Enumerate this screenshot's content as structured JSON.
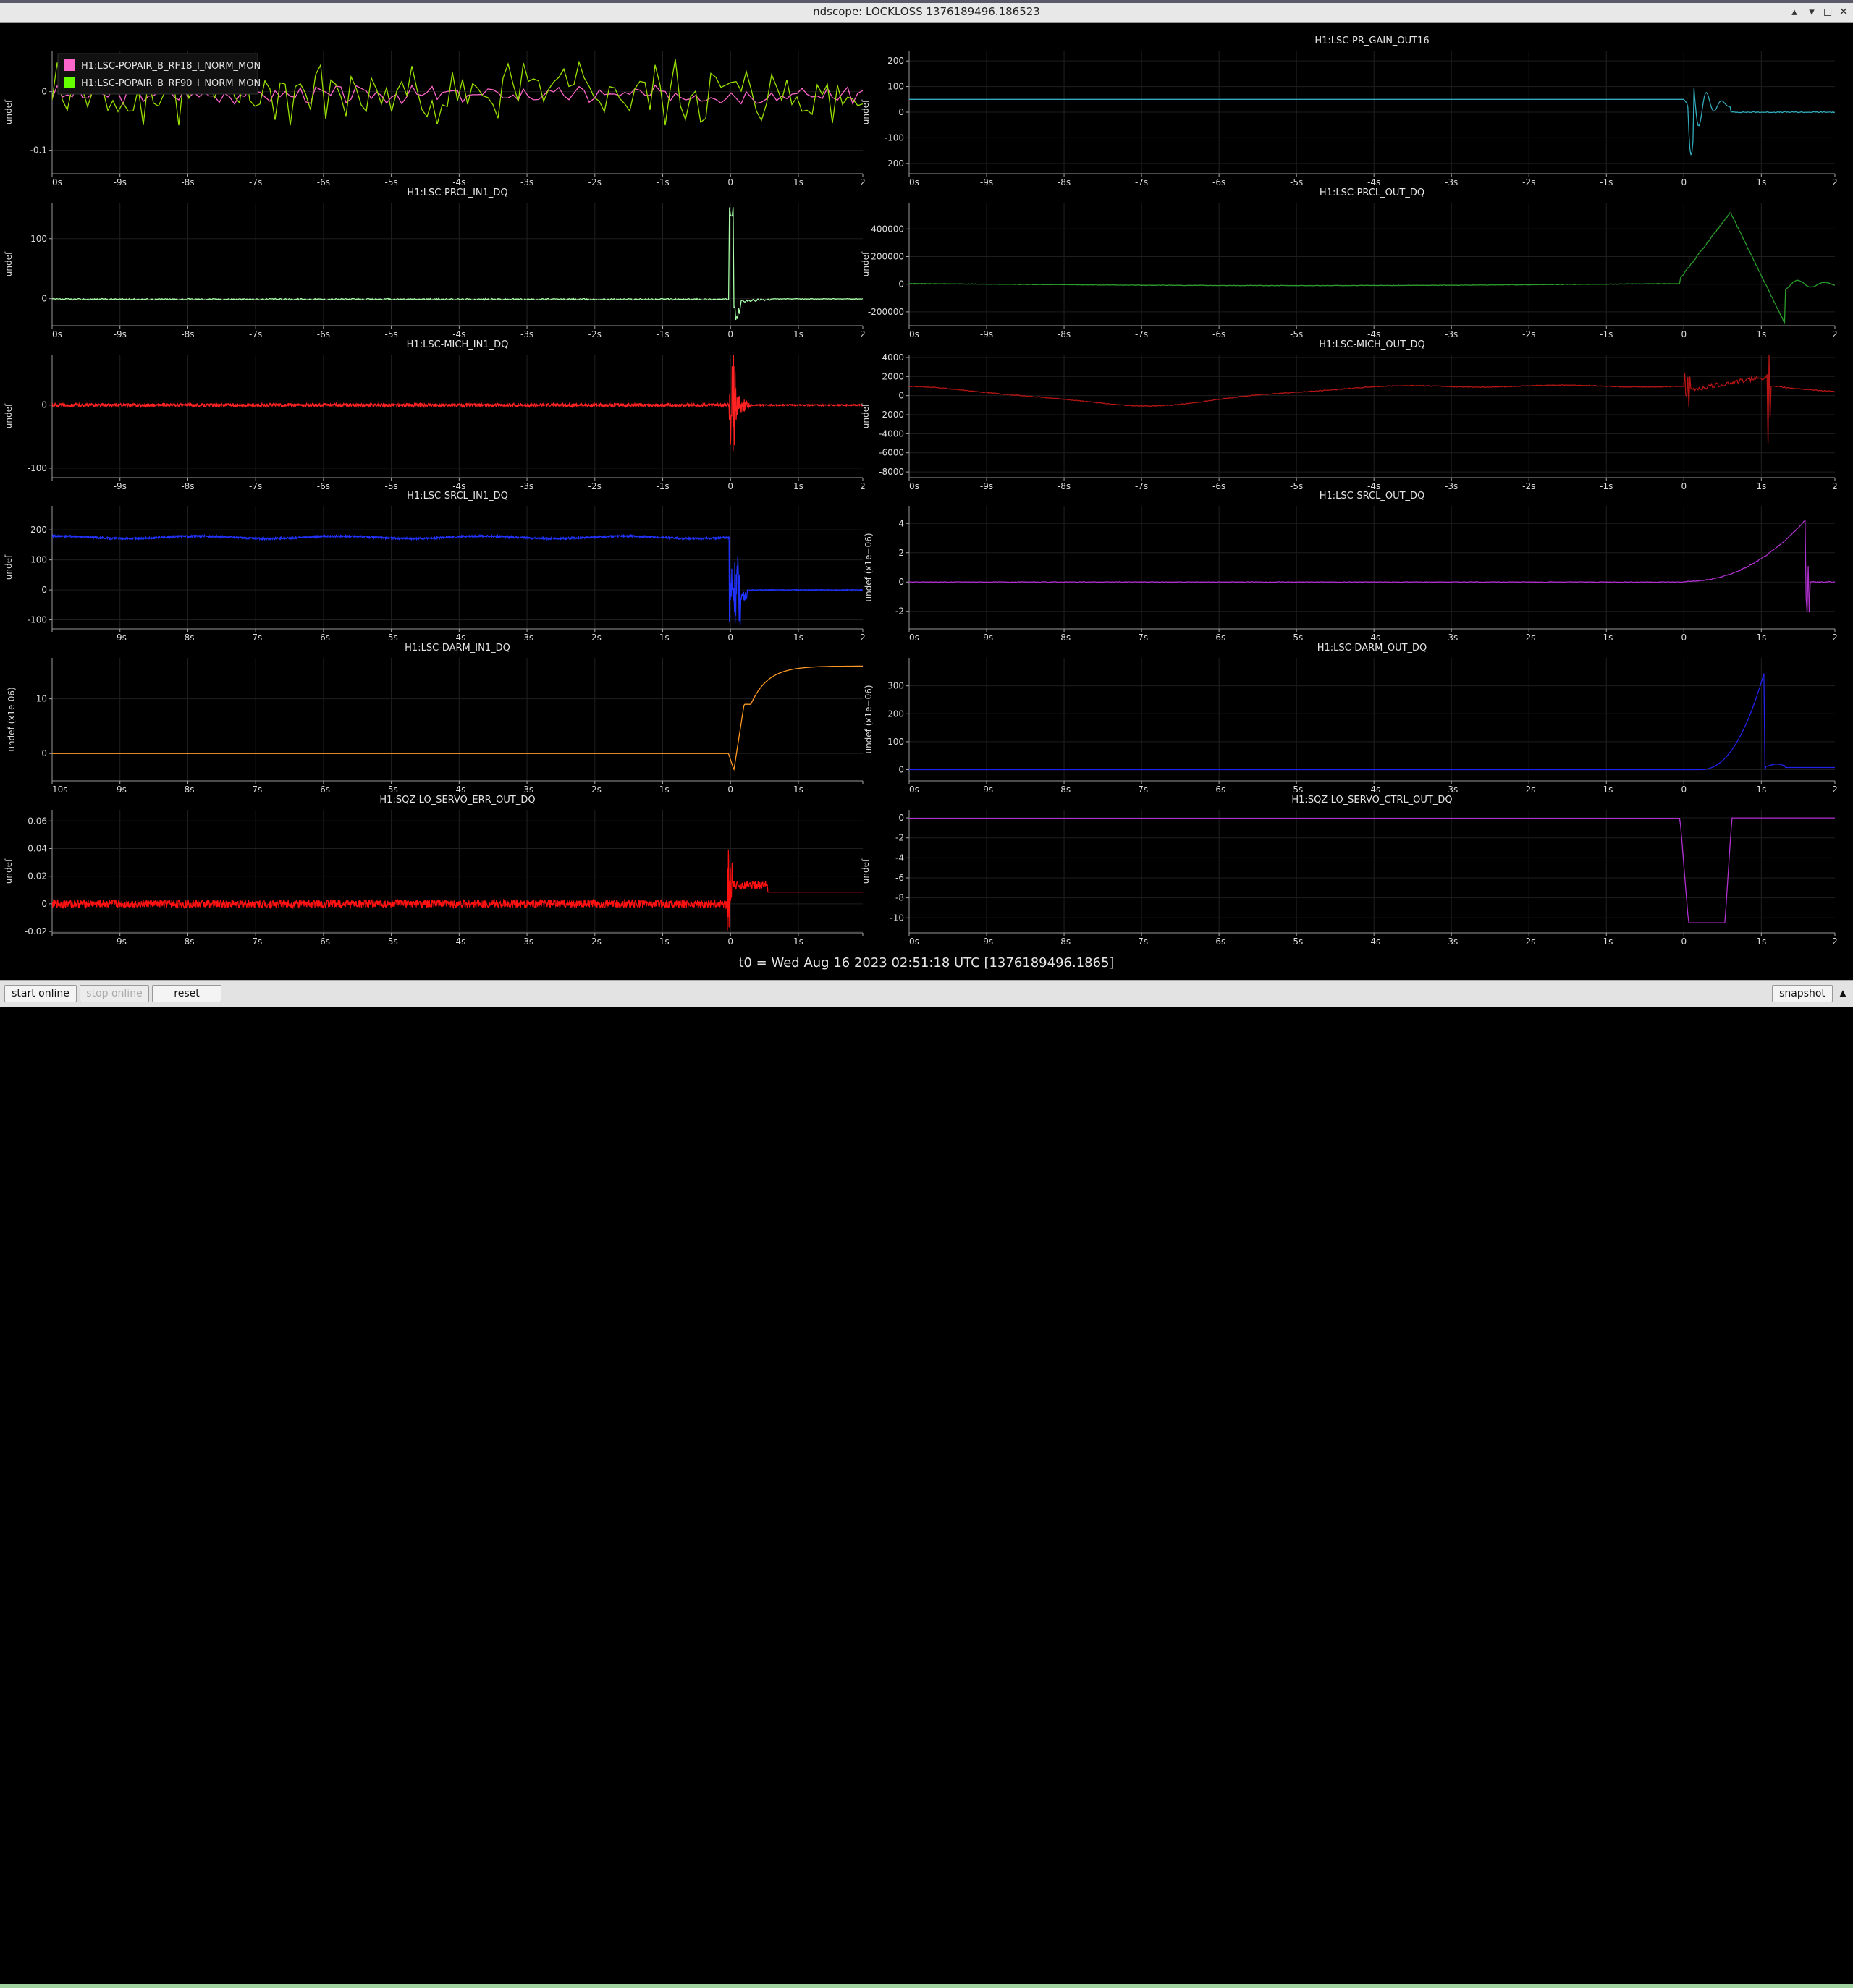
{
  "window": {
    "title": "ndscope: LOCKLOSS 1376189496.186523",
    "controls": [
      "▴",
      "▾",
      "◻",
      "✕"
    ]
  },
  "t0_label": "t0 = Wed Aug 16 2023 02:51:18 UTC [1376189496.1865]",
  "buttons": {
    "start_online": "start online",
    "stop_online": "stop online",
    "reset": "reset",
    "snapshot": "snapshot",
    "scroll_up": "▲"
  },
  "plots": [
    {
      "title": "",
      "ylabel": "undef",
      "yticks": [
        {
          "v": 0,
          "label": "0"
        },
        {
          "v": -0.1,
          "label": "-0.1"
        }
      ],
      "ylim": [
        -0.14,
        0.07
      ],
      "xticks": [
        "0s",
        "-9s",
        "-8s",
        "-7s",
        "-6s",
        "-5s",
        "-4s",
        "-3s",
        "-2s",
        "-1s",
        "0",
        "1s",
        "2"
      ],
      "legend": [
        {
          "label": "H1:LSC-POPAIR_B_RF18_I_NORM_MON",
          "color": "#ff66cc"
        },
        {
          "label": "H1:LSC-POPAIR_B_RF90_I_NORM_MON",
          "color": "#66ff00"
        }
      ],
      "series": [
        {
          "color": "#ff66cc",
          "shape": "noise",
          "base": -0.005,
          "amp": 0.012,
          "seed": 3
        },
        {
          "color": "#9ae000",
          "shape": "noise",
          "base": -0.005,
          "amp": 0.045,
          "seed": 7
        }
      ]
    },
    {
      "title": "H1:LSC-PR_GAIN_OUT16",
      "ylabel": "undef",
      "yticks": [
        {
          "v": 200,
          "label": "200"
        },
        {
          "v": 100,
          "label": "100"
        },
        {
          "v": 0,
          "label": "0"
        },
        {
          "v": -100,
          "label": "-100"
        },
        {
          "v": -200,
          "label": "-200"
        }
      ],
      "ylim": [
        -240,
        240
      ],
      "xticks": [
        "0s",
        "-9s",
        "-8s",
        "-7s",
        "-6s",
        "-5s",
        "-4s",
        "-3s",
        "-2s",
        "-1s",
        "0",
        "1s",
        "2"
      ],
      "series": [
        {
          "color": "#33aabb",
          "shape": "prgain"
        }
      ]
    },
    {
      "title": "H1:LSC-PRCL_IN1_DQ",
      "ylabel": "undef",
      "yticks": [
        {
          "v": 100,
          "label": "100"
        },
        {
          "v": 0,
          "label": "0"
        }
      ],
      "ylim": [
        -45,
        160
      ],
      "xticks": [
        "0s",
        "-9s",
        "-8s",
        "-7s",
        "-6s",
        "-5s",
        "-4s",
        "-3s",
        "-2s",
        "-1s",
        "0",
        "1s",
        "2"
      ],
      "series": [
        {
          "color": "#a8ffa8",
          "shape": "prclin"
        }
      ]
    },
    {
      "title": "H1:LSC-PRCL_OUT_DQ",
      "ylabel": "undef",
      "yticks": [
        {
          "v": 400000,
          "label": "400000"
        },
        {
          "v": 200000,
          "label": "200000"
        },
        {
          "v": 0,
          "label": "0"
        },
        {
          "v": -200000,
          "label": "-200000"
        }
      ],
      "ylim": [
        -300000,
        590000
      ],
      "xticks": [
        "0s",
        "-9s",
        "-8s",
        "-7s",
        "-6s",
        "-5s",
        "-4s",
        "-3s",
        "-2s",
        "-1s",
        "0",
        "1s",
        "2"
      ],
      "series": [
        {
          "color": "#2a9d2a",
          "shape": "prclout"
        }
      ]
    },
    {
      "title": "H1:LSC-MICH_IN1_DQ",
      "ylabel": "undef",
      "yticks": [
        {
          "v": 0,
          "label": "0"
        },
        {
          "v": -100,
          "label": "-100"
        }
      ],
      "ylim": [
        -115,
        80
      ],
      "xticks": [
        "",
        "-9s",
        "-8s",
        "-7s",
        "-6s",
        "-5s",
        "-4s",
        "-3s",
        "-2s",
        "-1s",
        "0",
        "1s",
        "2"
      ],
      "series": [
        {
          "color": "#ff2222",
          "shape": "michin"
        }
      ]
    },
    {
      "title": "H1:LSC-MICH_OUT_DQ",
      "ylabel": "undef",
      "yticks": [
        {
          "v": 4000,
          "label": "4000"
        },
        {
          "v": 2000,
          "label": "2000"
        },
        {
          "v": 0,
          "label": "0"
        },
        {
          "v": -2000,
          "label": "-2000"
        },
        {
          "v": -4000,
          "label": "-4000"
        },
        {
          "v": -6000,
          "label": "-6000"
        },
        {
          "v": -8000,
          "label": "-8000"
        }
      ],
      "ylim": [
        -8600,
        4300
      ],
      "xticks": [
        "0s",
        "-9s",
        "-8s",
        "-7s",
        "-6s",
        "-5s",
        "-4s",
        "-3s",
        "-2s",
        "-1s",
        "0",
        "1s",
        "2"
      ],
      "series": [
        {
          "color": "#b51515",
          "shape": "michout"
        }
      ]
    },
    {
      "title": "H1:LSC-SRCL_IN1_DQ",
      "ylabel": "undef",
      "yticks": [
        {
          "v": 200,
          "label": "200"
        },
        {
          "v": 100,
          "label": "100"
        },
        {
          "v": 0,
          "label": "0"
        },
        {
          "v": -100,
          "label": "-100"
        }
      ],
      "ylim": [
        -130,
        280
      ],
      "xticks": [
        "",
        "-9s",
        "-8s",
        "-7s",
        "-6s",
        "-5s",
        "-4s",
        "-3s",
        "-2s",
        "-1s",
        "0",
        "1s",
        "2"
      ],
      "series": [
        {
          "color": "#2233ff",
          "shape": "srclin"
        }
      ]
    },
    {
      "title": "H1:LSC-SRCL_OUT_DQ",
      "ylabel": "undef (x1e+06)",
      "yticks": [
        {
          "v": 4,
          "label": "4"
        },
        {
          "v": 2,
          "label": "2"
        },
        {
          "v": 0,
          "label": "0"
        },
        {
          "v": -2,
          "label": "-2"
        }
      ],
      "ylim": [
        -3.2,
        5.2
      ],
      "xticks": [
        "0s",
        "-9s",
        "-8s",
        "-7s",
        "-6s",
        "-5s",
        "-4s",
        "-3s",
        "-2s",
        "-1s",
        "0",
        "1s",
        "2"
      ],
      "series": [
        {
          "color": "#b030d0",
          "shape": "srclout"
        }
      ]
    },
    {
      "title": "H1:LSC-DARM_IN1_DQ",
      "ylabel": "undef (x1e-06)",
      "yticks": [
        {
          "v": 10,
          "label": "10"
        },
        {
          "v": 0,
          "label": "0"
        }
      ],
      "ylim": [
        -5,
        17.5
      ],
      "xticks": [
        "10s",
        "-9s",
        "-8s",
        "-7s",
        "-6s",
        "-5s",
        "-4s",
        "-3s",
        "-2s",
        "-1s",
        "0",
        "1s",
        ""
      ],
      "series": [
        {
          "color": "#ff9922",
          "shape": "darmin"
        }
      ]
    },
    {
      "title": "H1:LSC-DARM_OUT_DQ",
      "ylabel": "undef (x1e+06)",
      "yticks": [
        {
          "v": 300,
          "label": "300"
        },
        {
          "v": 200,
          "label": "200"
        },
        {
          "v": 100,
          "label": "100"
        },
        {
          "v": 0,
          "label": "0"
        }
      ],
      "ylim": [
        -40,
        400
      ],
      "xticks": [
        "0s",
        "-9s",
        "-8s",
        "-7s",
        "-6s",
        "-5s",
        "-4s",
        "-3s",
        "-2s",
        "-1s",
        "0",
        "1s",
        "2"
      ],
      "series": [
        {
          "color": "#2222ee",
          "shape": "darmout"
        }
      ]
    },
    {
      "title": "H1:SQZ-LO_SERVO_ERR_OUT_DQ",
      "ylabel": "undef",
      "yticks": [
        {
          "v": 0.06,
          "label": "0.06"
        },
        {
          "v": 0.04,
          "label": "0.04"
        },
        {
          "v": 0.02,
          "label": "0.02"
        },
        {
          "v": 0,
          "label": "0"
        },
        {
          "v": -0.02,
          "label": "-0.02"
        }
      ],
      "ylim": [
        -0.021,
        0.068
      ],
      "xticks": [
        "",
        "-9s",
        "-8s",
        "-7s",
        "-6s",
        "-5s",
        "-4s",
        "-3s",
        "-2s",
        "-1s",
        "0",
        "1s",
        ""
      ],
      "series": [
        {
          "color": "#ff1111",
          "shape": "sqzerr"
        }
      ]
    },
    {
      "title": "H1:SQZ-LO_SERVO_CTRL_OUT_DQ",
      "ylabel": "undef",
      "yticks": [
        {
          "v": 0,
          "label": "0"
        },
        {
          "v": -2,
          "label": "-2"
        },
        {
          "v": -4,
          "label": "-4"
        },
        {
          "v": -6,
          "label": "-6"
        },
        {
          "v": -8,
          "label": "-8"
        },
        {
          "v": -10,
          "label": "-10"
        }
      ],
      "ylim": [
        -11.5,
        0.8
      ],
      "xticks": [
        "0s",
        "-9s",
        "-8s",
        "-7s",
        "-6s",
        "-5s",
        "-4s",
        "-3s",
        "-2s",
        "-1s",
        "0",
        "1s",
        "2"
      ],
      "series": [
        {
          "color": "#b030d0",
          "shape": "sqzctrl"
        }
      ]
    }
  ]
}
